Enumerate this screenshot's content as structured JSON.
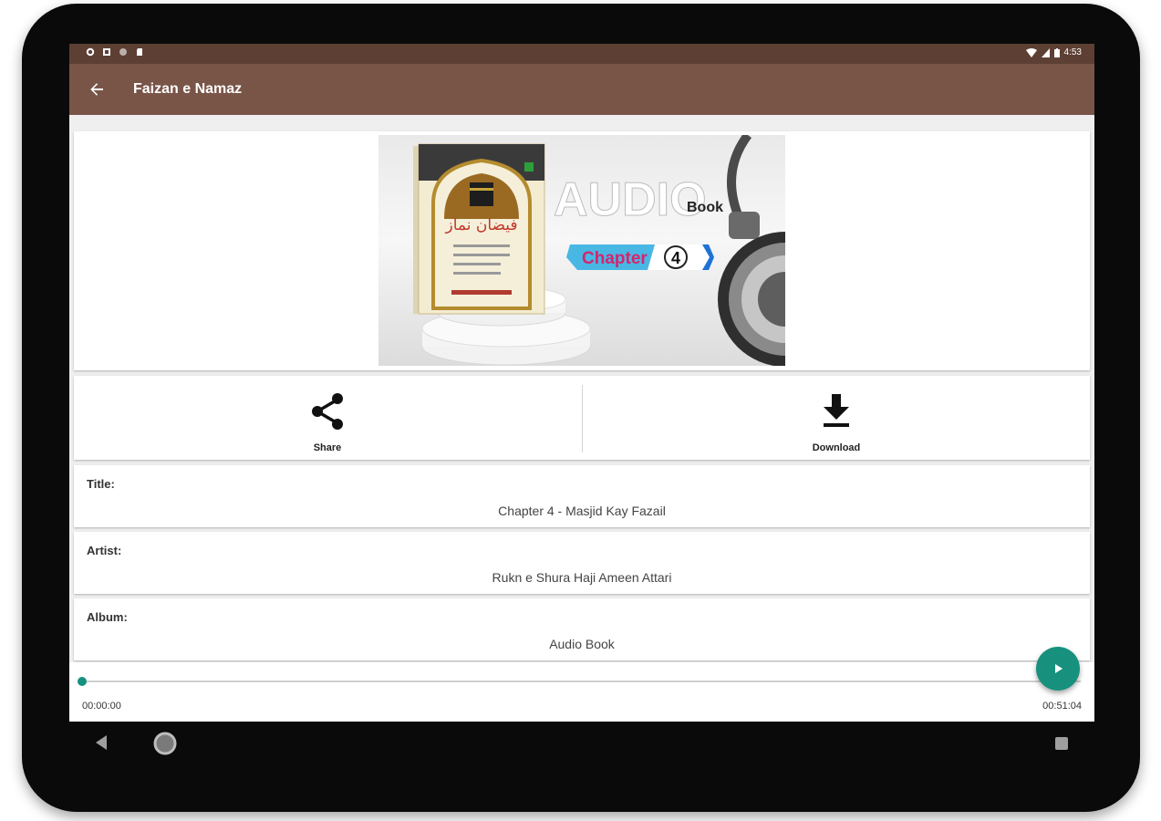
{
  "status_bar": {
    "time": "4:53"
  },
  "app_bar": {
    "title": "Faizan e Namaz",
    "back_icon": "arrow-left-icon"
  },
  "cover": {
    "headline": "AUDIO",
    "headline_sub": "Book",
    "chapter_label": "Chapter",
    "chapter_number": "4"
  },
  "actions": {
    "share_label": "Share",
    "download_label": "Download"
  },
  "info": {
    "title_label": "Title:",
    "title_value": "Chapter 4 - Masjid Kay Fazail",
    "artist_label": "Artist:",
    "artist_value": "Rukn e Shura Haji Ameen Attari",
    "album_label": "Album:",
    "album_value": "Audio Book"
  },
  "player": {
    "current_time": "00:00:00",
    "total_time": "00:51:04",
    "progress": 0.0
  },
  "colors": {
    "status_bar": "#5d3f34",
    "app_bar": "#795548",
    "accent": "#17917e"
  }
}
